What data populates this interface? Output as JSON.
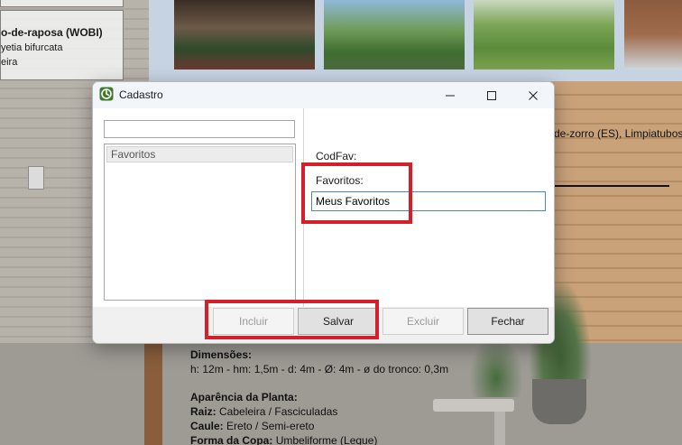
{
  "background": {
    "card_title": "o-de-raposa (WOBI)",
    "card_line1": "yetia bifurcata",
    "card_line2": "eira",
    "right_text": "de-zorro (ES), Limpiatubos",
    "dimensions_label": "Dimensões:",
    "dimensions_value": "h: 12m - hm: 1,5m - d: 4m - Ø: 4m - ø do tronco: 0,3m",
    "appearance_label": "Aparência da Planta:",
    "root_label": "Raiz:",
    "root_value": "Cabeleira / Fasciculadas",
    "stem_label": "Caule:",
    "stem_value": "Ereto / Semi-ereto",
    "crown_label": "Forma da Copa:",
    "crown_value": "Umbeliforme (Leque)"
  },
  "dialog": {
    "title": "Cadastro",
    "search_value": "",
    "list_items": [
      "Favoritos"
    ],
    "codfav_label": "CodFav:",
    "favoritos_label": "Favoritos:",
    "favoritos_value": "Meus Favoritos",
    "buttons": {
      "incluir": "Incluir",
      "salvar": "Salvar",
      "excluir": "Excluir",
      "fechar": "Fechar"
    }
  },
  "colors": {
    "highlight_red": "#d4202a",
    "input_focus_border": "#4a8ab8",
    "app_icon_green": "#3f7a2c"
  },
  "icons": [
    "app-icon",
    "minimize-icon",
    "maximize-icon",
    "close-icon",
    "resize-grip-icon"
  ]
}
